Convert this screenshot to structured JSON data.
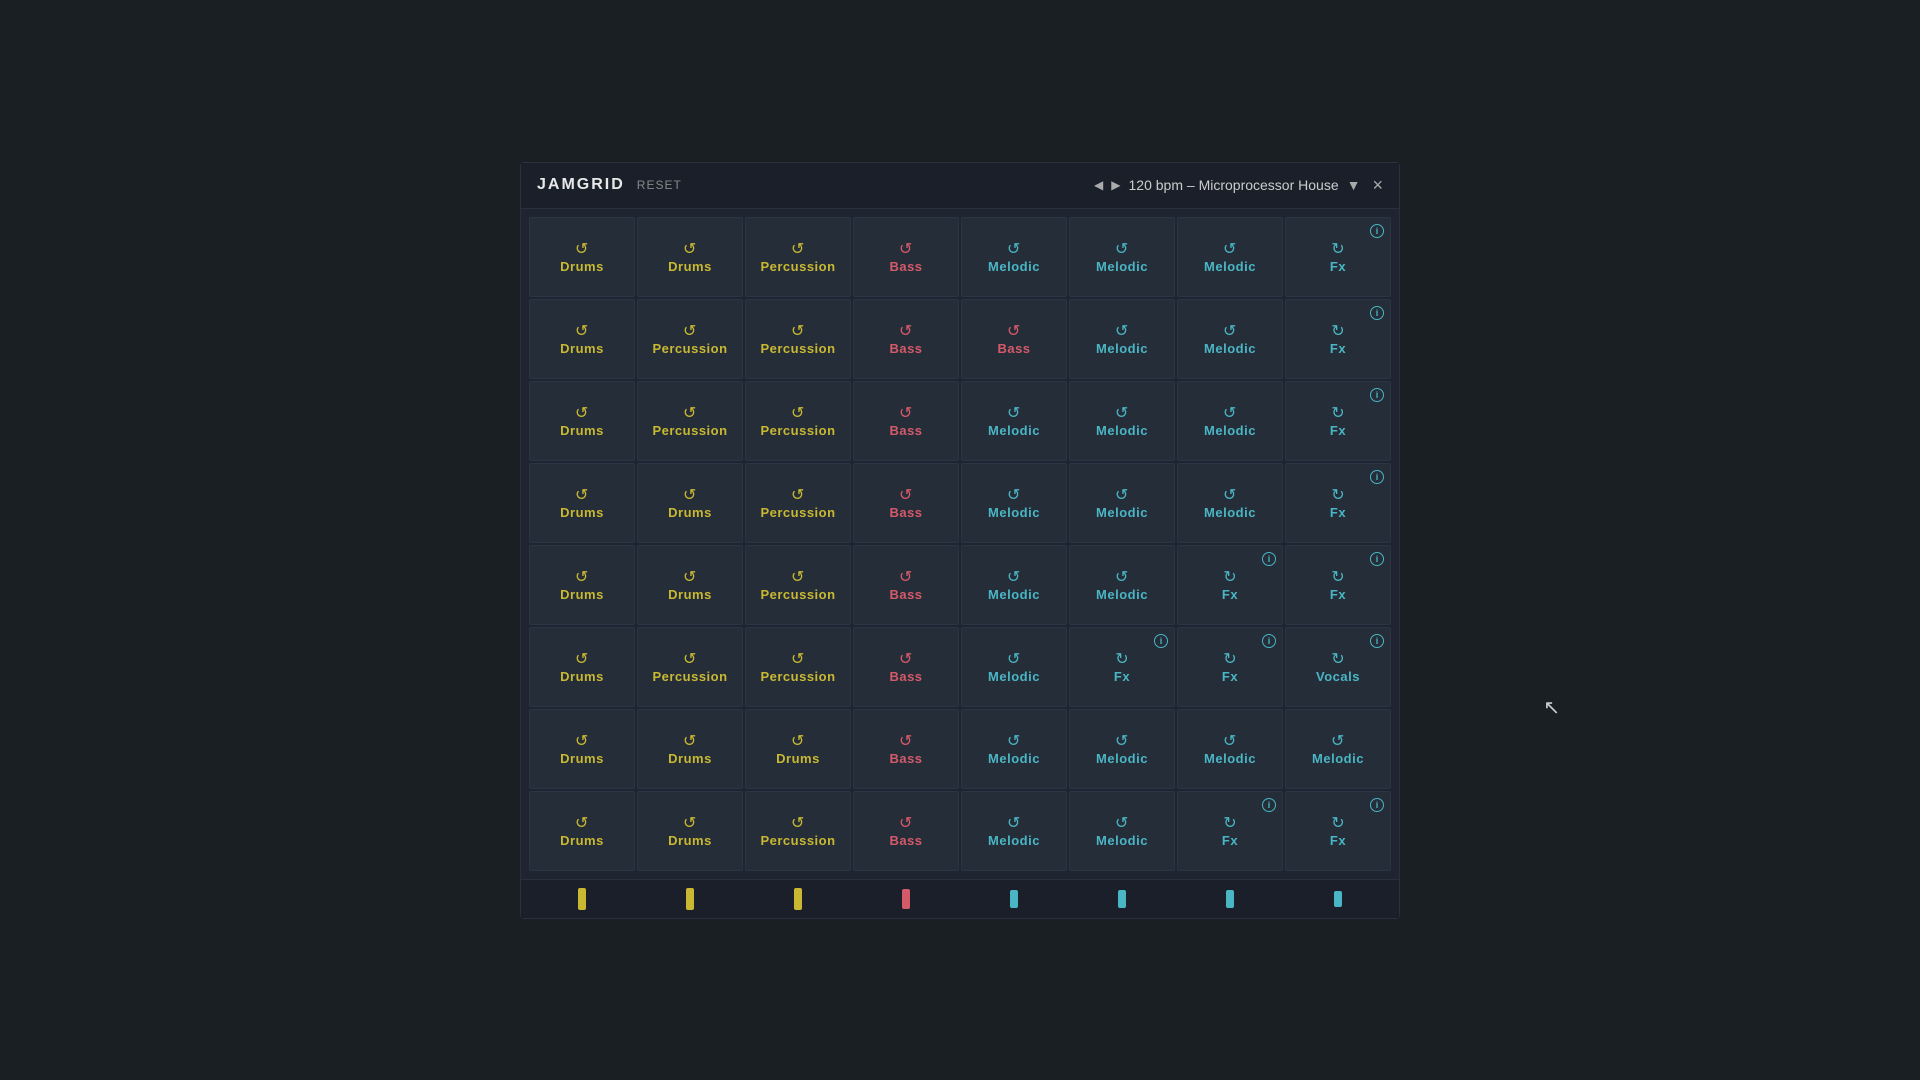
{
  "app": {
    "title": "JAMGRID",
    "reset_label": "RESET",
    "bpm_label": "120 bpm – Microprocessor House",
    "close_label": "×"
  },
  "colors": {
    "drums": "#c8b832",
    "percussion": "#c8b832",
    "bass": "#d45a6a",
    "melodic": "#4ab5c4",
    "fx": "#4ab5c4",
    "vocals": "#4ab5c4"
  },
  "grid": {
    "rows": [
      [
        {
          "type": "drums",
          "label": "Drums",
          "icon": "refresh",
          "info": false
        },
        {
          "type": "drums",
          "label": "Drums",
          "icon": "refresh",
          "info": false
        },
        {
          "type": "percussion",
          "label": "Percussion",
          "icon": "refresh",
          "info": false
        },
        {
          "type": "bass",
          "label": "Bass",
          "icon": "refresh",
          "info": false
        },
        {
          "type": "melodic",
          "label": "Melodic",
          "icon": "refresh",
          "info": false
        },
        {
          "type": "melodic",
          "label": "Melodic",
          "icon": "refresh",
          "info": false
        },
        {
          "type": "melodic",
          "label": "Melodic",
          "icon": "refresh",
          "info": false
        },
        {
          "type": "fx",
          "label": "Fx",
          "icon": "info",
          "info": true
        }
      ],
      [
        {
          "type": "drums",
          "label": "Drums",
          "icon": "refresh",
          "info": false
        },
        {
          "type": "percussion",
          "label": "Percussion",
          "icon": "refresh",
          "info": false
        },
        {
          "type": "percussion",
          "label": "Percussion",
          "icon": "refresh",
          "info": false
        },
        {
          "type": "bass",
          "label": "Bass",
          "icon": "refresh",
          "info": false
        },
        {
          "type": "bass",
          "label": "Bass",
          "icon": "refresh",
          "info": false
        },
        {
          "type": "melodic",
          "label": "Melodic",
          "icon": "refresh",
          "info": false
        },
        {
          "type": "melodic",
          "label": "Melodic",
          "icon": "refresh",
          "info": false
        },
        {
          "type": "fx",
          "label": "Fx",
          "icon": "info",
          "info": true
        }
      ],
      [
        {
          "type": "drums",
          "label": "Drums",
          "icon": "refresh",
          "info": false
        },
        {
          "type": "percussion",
          "label": "Percussion",
          "icon": "refresh",
          "info": false
        },
        {
          "type": "percussion",
          "label": "Percussion",
          "icon": "refresh",
          "info": false
        },
        {
          "type": "bass",
          "label": "Bass",
          "icon": "refresh",
          "info": false
        },
        {
          "type": "melodic",
          "label": "Melodic",
          "icon": "refresh",
          "info": false
        },
        {
          "type": "melodic",
          "label": "Melodic",
          "icon": "refresh",
          "info": false
        },
        {
          "type": "melodic",
          "label": "Melodic",
          "icon": "refresh",
          "info": false
        },
        {
          "type": "fx",
          "label": "Fx",
          "icon": "info",
          "info": true
        }
      ],
      [
        {
          "type": "drums",
          "label": "Drums",
          "icon": "refresh",
          "info": false
        },
        {
          "type": "drums",
          "label": "Drums",
          "icon": "refresh",
          "info": false
        },
        {
          "type": "percussion",
          "label": "Percussion",
          "icon": "refresh",
          "info": false
        },
        {
          "type": "bass",
          "label": "Bass",
          "icon": "refresh",
          "info": false
        },
        {
          "type": "melodic",
          "label": "Melodic",
          "icon": "refresh",
          "info": false
        },
        {
          "type": "melodic",
          "label": "Melodic",
          "icon": "refresh",
          "info": false
        },
        {
          "type": "melodic",
          "label": "Melodic",
          "icon": "refresh",
          "info": false
        },
        {
          "type": "fx",
          "label": "Fx",
          "icon": "info",
          "info": true
        }
      ],
      [
        {
          "type": "drums",
          "label": "Drums",
          "icon": "refresh",
          "info": false
        },
        {
          "type": "drums",
          "label": "Drums",
          "icon": "refresh",
          "info": false
        },
        {
          "type": "percussion",
          "label": "Percussion",
          "icon": "refresh",
          "info": false
        },
        {
          "type": "bass",
          "label": "Bass",
          "icon": "refresh",
          "info": false
        },
        {
          "type": "melodic",
          "label": "Melodic",
          "icon": "refresh",
          "info": false
        },
        {
          "type": "melodic",
          "label": "Melodic",
          "icon": "refresh",
          "info": false
        },
        {
          "type": "fx",
          "label": "Fx",
          "icon": "info",
          "info": true
        },
        {
          "type": "fx",
          "label": "Fx",
          "icon": "info",
          "info": true
        }
      ],
      [
        {
          "type": "drums",
          "label": "Drums",
          "icon": "refresh",
          "info": false
        },
        {
          "type": "percussion",
          "label": "Percussion",
          "icon": "refresh",
          "info": false
        },
        {
          "type": "percussion",
          "label": "Percussion",
          "icon": "refresh",
          "info": false
        },
        {
          "type": "bass",
          "label": "Bass",
          "icon": "refresh",
          "info": false
        },
        {
          "type": "melodic",
          "label": "Melodic",
          "icon": "refresh",
          "info": false
        },
        {
          "type": "fx",
          "label": "Fx",
          "icon": "info",
          "info": true
        },
        {
          "type": "fx",
          "label": "Fx",
          "icon": "info",
          "info": true
        },
        {
          "type": "vocals",
          "label": "Vocals",
          "icon": "info",
          "info": true
        }
      ],
      [
        {
          "type": "drums",
          "label": "Drums",
          "icon": "refresh",
          "info": false
        },
        {
          "type": "drums",
          "label": "Drums",
          "icon": "refresh",
          "info": false
        },
        {
          "type": "drums",
          "label": "Drums",
          "icon": "refresh",
          "info": false
        },
        {
          "type": "bass",
          "label": "Bass",
          "icon": "refresh",
          "info": false
        },
        {
          "type": "melodic",
          "label": "Melodic",
          "icon": "refresh",
          "info": false
        },
        {
          "type": "melodic",
          "label": "Melodic",
          "icon": "refresh",
          "info": false
        },
        {
          "type": "melodic",
          "label": "Melodic",
          "icon": "refresh",
          "info": false
        },
        {
          "type": "melodic",
          "label": "Melodic",
          "icon": "refresh",
          "info": false
        }
      ],
      [
        {
          "type": "drums",
          "label": "Drums",
          "icon": "refresh",
          "info": false
        },
        {
          "type": "drums",
          "label": "Drums",
          "icon": "refresh",
          "info": false
        },
        {
          "type": "percussion",
          "label": "Percussion",
          "icon": "refresh",
          "info": false
        },
        {
          "type": "bass",
          "label": "Bass",
          "icon": "refresh",
          "info": false
        },
        {
          "type": "melodic",
          "label": "Melodic",
          "icon": "refresh",
          "info": false
        },
        {
          "type": "melodic",
          "label": "Melodic",
          "icon": "refresh",
          "info": false
        },
        {
          "type": "fx",
          "label": "Fx",
          "icon": "info",
          "info": true
        },
        {
          "type": "fx",
          "label": "Fx",
          "icon": "info",
          "info": true
        }
      ]
    ],
    "col_bars": [
      {
        "color": "drums"
      },
      {
        "color": "drums"
      },
      {
        "color": "drums"
      },
      {
        "color": "bass"
      },
      {
        "color": "melodic"
      },
      {
        "color": "melodic"
      },
      {
        "color": "melodic"
      },
      {
        "color": "melodic"
      }
    ]
  }
}
